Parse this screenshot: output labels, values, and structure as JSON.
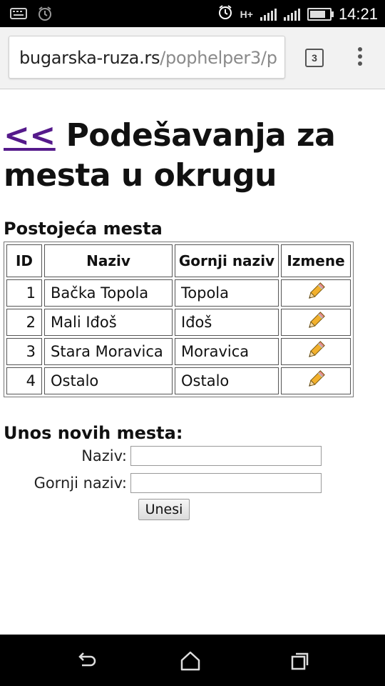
{
  "status_bar": {
    "time": "14:21",
    "network": "H+",
    "battery_level": 0.8,
    "icons": [
      "keyboard-icon",
      "alarm-clock-icon",
      "alarm-icon",
      "hplus-icon",
      "signal-icon",
      "signal-icon",
      "battery-icon"
    ]
  },
  "browser": {
    "url_domain": "bugarska-ruza.rs",
    "url_path": "/pophelper3/p",
    "tab_count": "3",
    "menu_icon": "overflow-menu-icon"
  },
  "page": {
    "back_link": "<<",
    "title": "Podešavanja za mesta u okrugu",
    "existing_heading": "Postojeća mesta",
    "table": {
      "headers": [
        "ID",
        "Naziv",
        "Gornji naziv",
        "Izmene"
      ],
      "rows": [
        {
          "id": "1",
          "naziv": "Bačka Topola",
          "gornji": "Topola"
        },
        {
          "id": "2",
          "naziv": "Mali Iđoš",
          "gornji": "Iđoš"
        },
        {
          "id": "3",
          "naziv": "Stara Moravica",
          "gornji": "Moravica"
        },
        {
          "id": "4",
          "naziv": "Ostalo",
          "gornji": "Ostalo"
        }
      ],
      "edit_icon": "pencil-icon"
    },
    "new_heading": "Unos novih mesta:",
    "form": {
      "naziv_label": "Naziv:",
      "naziv_value": "",
      "gornji_label": "Gornji naziv:",
      "gornji_value": "",
      "submit_label": "Unesi"
    }
  },
  "nav_bar": {
    "icons": [
      "back-icon",
      "home-icon",
      "recent-apps-icon"
    ]
  }
}
